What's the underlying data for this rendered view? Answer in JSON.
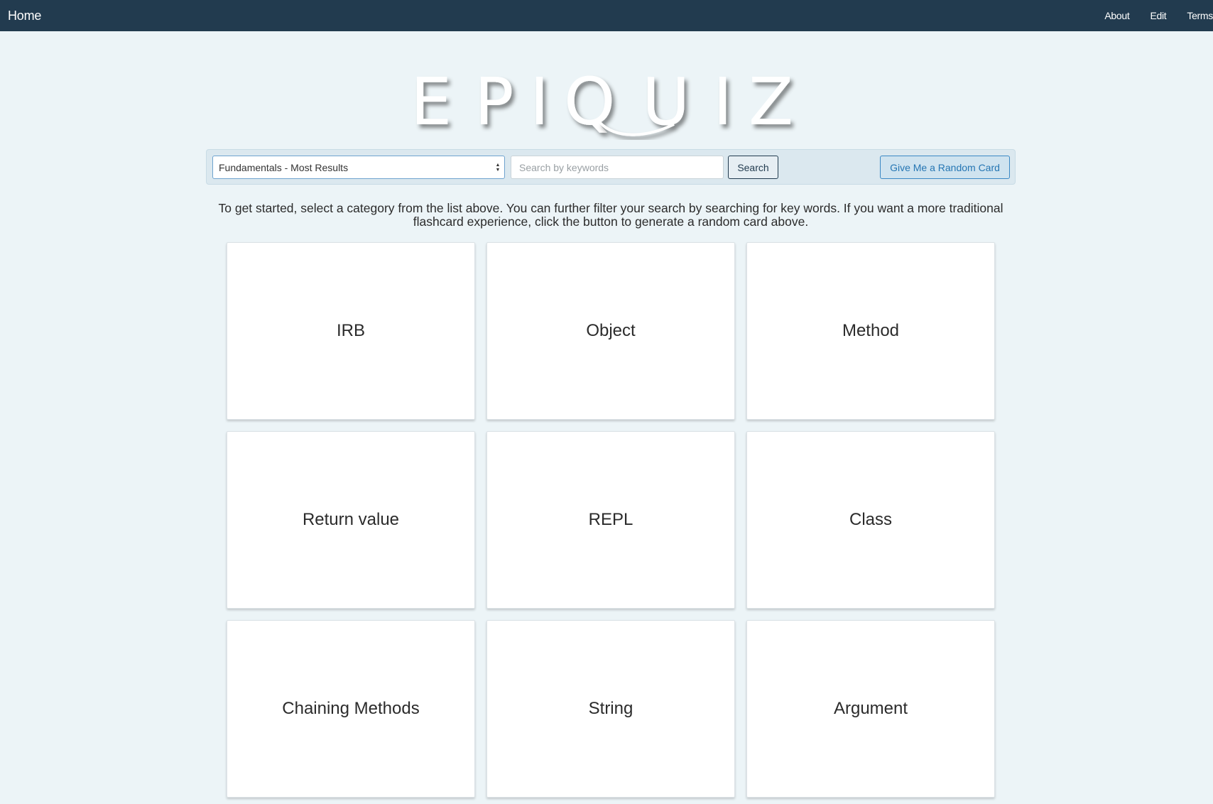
{
  "navbar": {
    "brand": "Home",
    "links": [
      "About",
      "Edit",
      "Terms"
    ]
  },
  "logo": {
    "text": "EPIQUIZ",
    "letters": [
      "E",
      "P",
      "I",
      "Q",
      "U",
      "I",
      "Z"
    ]
  },
  "toolbar": {
    "category_selected": "Fundamentals - Most Results",
    "search_placeholder": "Search by keywords",
    "search_value": "",
    "search_label": "Search",
    "random_label": "Give Me a Random Card"
  },
  "intro": {
    "text": "To get started, select a category from the list above. You can further filter your search by searching for key words. If you want a more traditional flashcard experience, click the button to generate a random card above."
  },
  "cards": [
    "IRB",
    "Object",
    "Method",
    "Return value",
    "REPL",
    "Class",
    "Chaining Methods",
    "String",
    "Argument"
  ],
  "colors": {
    "navbar_bg": "#223b4f",
    "page_bg": "#ecf4f7",
    "accent_blue": "#2576b3"
  }
}
